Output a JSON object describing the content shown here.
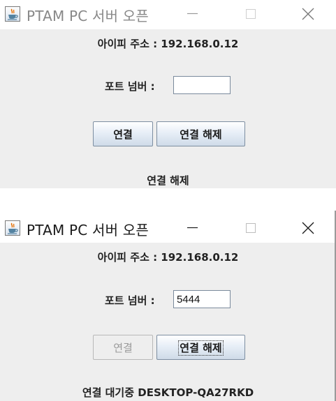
{
  "windows": [
    {
      "title": "PTAM PC 서버 오픈",
      "ip_label": "아이피 주소 : 192.168.0.12",
      "port_label": "포트 넘버 :",
      "port_value": "",
      "connect_label": "연결",
      "disconnect_label": "연결 해제",
      "status": "연결 해제"
    },
    {
      "title": "PTAM PC 서버 오픈",
      "ip_label": "아이피 주소 : 192.168.0.12",
      "port_label": "포트 넘버 :",
      "port_value": "5444",
      "connect_label": "연결",
      "disconnect_label": "연결 해제",
      "status": "연결 대기중 DESKTOP-QA27RKD"
    }
  ],
  "icons": {
    "app": "java-coffee-cup-icon",
    "minimize": "minimize-icon",
    "maximize": "maximize-icon",
    "close": "close-icon"
  },
  "colors": {
    "content_bg": "#eeeeee",
    "button_border": "#7d8ea1",
    "disabled_text": "#9a9a9a",
    "java_orange": "#e76f00",
    "java_blue": "#5382a1"
  }
}
